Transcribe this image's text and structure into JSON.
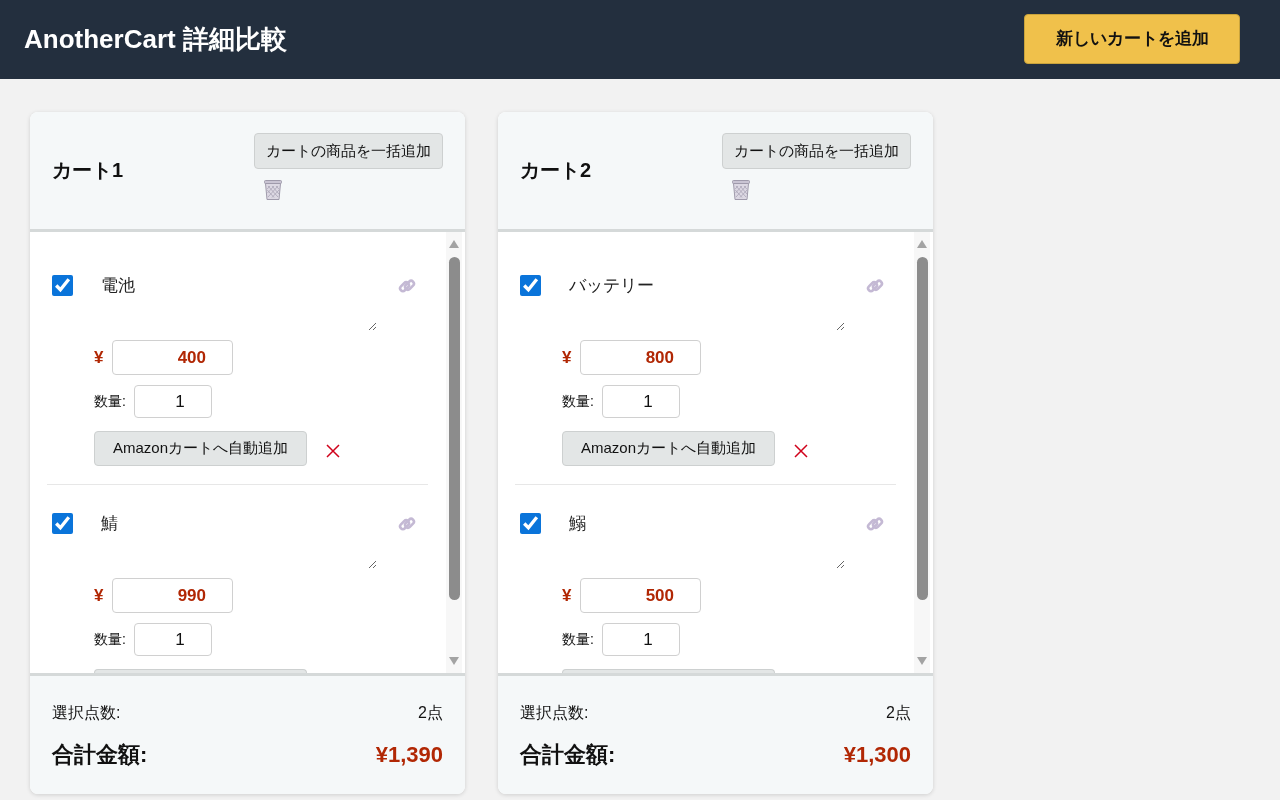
{
  "header": {
    "title": "AnotherCart 詳細比較",
    "add_cart_button": "新しいカートを追加"
  },
  "carts": [
    {
      "title": "カート1",
      "bulk_add_button": "カートの商品を一括追加",
      "items": [
        {
          "checked": true,
          "name": "電池",
          "currency": "¥",
          "price": "400",
          "quantity_label": "数量:",
          "quantity": "1",
          "add_button": "Amazonカートへ自動追加"
        },
        {
          "checked": true,
          "name": "鯖",
          "currency": "¥",
          "price": "990",
          "quantity_label": "数量:",
          "quantity": "1"
        }
      ],
      "selected_count_label": "選択点数:",
      "selected_count": "2点",
      "total_label": "合計金額:",
      "total": "¥1,390"
    },
    {
      "title": "カート2",
      "bulk_add_button": "カートの商品を一括追加",
      "items": [
        {
          "checked": true,
          "name": "バッテリー",
          "currency": "¥",
          "price": "800",
          "quantity_label": "数量:",
          "quantity": "1",
          "add_button": "Amazonカートへ自動追加"
        },
        {
          "checked": true,
          "name": "鰯",
          "currency": "¥",
          "price": "500",
          "quantity_label": "数量:",
          "quantity": "1"
        }
      ],
      "selected_count_label": "選択点数:",
      "selected_count": "2点",
      "total_label": "合計金額:",
      "total": "¥1,300"
    }
  ]
}
